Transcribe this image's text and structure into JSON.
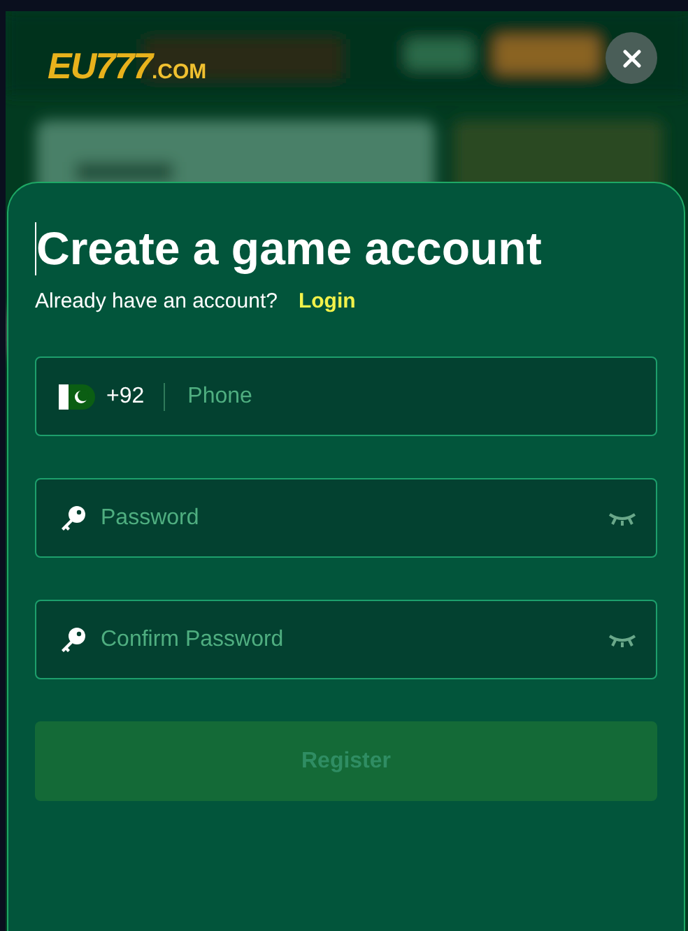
{
  "logo": {
    "brand": "EU777",
    "suffix": ".COM"
  },
  "modal": {
    "title": "Create a game account",
    "prompt": "Already have an account?",
    "login_link": "Login",
    "fields": [
      {
        "kind": "phone",
        "country_code": "+92",
        "placeholder": "Phone"
      },
      {
        "kind": "password",
        "placeholder": "Password"
      },
      {
        "kind": "password",
        "placeholder": "Confirm Password"
      }
    ],
    "submit": {
      "label": "Register",
      "disabled": true
    }
  }
}
